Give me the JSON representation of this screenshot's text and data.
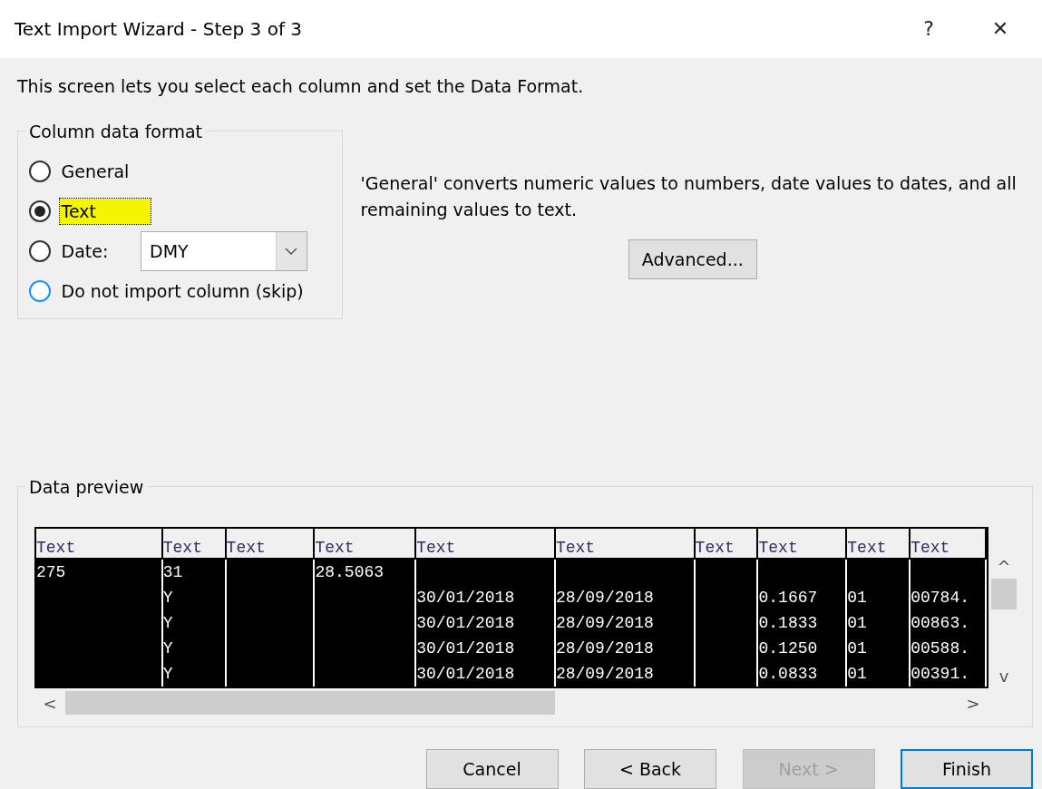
{
  "window": {
    "title": "Text Import Wizard - Step 3 of 3",
    "help": "?",
    "close": "✕"
  },
  "intro": "This screen lets you select each column and set the Data Format.",
  "column_format": {
    "legend": "Column data format",
    "options": [
      {
        "kind": "radio",
        "label": "General",
        "selected": false,
        "highlighted": false,
        "focused": false,
        "hover": false
      },
      {
        "kind": "radio",
        "label": "Text",
        "selected": true,
        "highlighted": true,
        "focused": true,
        "hover": false
      },
      {
        "kind": "select",
        "label": "Date:",
        "selected": false,
        "highlighted": false,
        "focused": false,
        "hover": false,
        "value": "DMY"
      },
      {
        "kind": "radio",
        "label": "Do not import column (skip)",
        "selected": false,
        "highlighted": false,
        "focused": false,
        "hover": true
      }
    ]
  },
  "description": "'General' converts numeric values to numbers, date values to dates, and all remaining values to text.",
  "advanced_button": "Advanced...",
  "preview": {
    "legend": "Data preview",
    "columns": [
      "Text",
      "Text",
      "Text",
      "Text",
      "Text",
      "Text",
      "Text",
      "Text",
      "Text",
      "Text"
    ],
    "rows": [
      [
        "275",
        "31",
        "",
        "28.5063",
        "",
        "",
        "",
        "",
        "",
        ""
      ],
      [
        "",
        "Y",
        "",
        "",
        "30/01/2018",
        "28/09/2018",
        "",
        "0.1667",
        "01",
        "00784."
      ],
      [
        "",
        "Y",
        "",
        "",
        "30/01/2018",
        "28/09/2018",
        "",
        "0.1833",
        "01",
        "00863."
      ],
      [
        "",
        "Y",
        "",
        "",
        "30/01/2018",
        "28/09/2018",
        "",
        "0.1250",
        "01",
        "00588."
      ],
      [
        "",
        "Y",
        "",
        "",
        "30/01/2018",
        "28/09/2018",
        "",
        "0.0833",
        "01",
        "00391."
      ]
    ],
    "scroll_up": "^",
    "scroll_down": "v",
    "scroll_left": "<",
    "scroll_right": ">"
  },
  "buttons": [
    {
      "label": "Cancel",
      "disabled": false,
      "default": false
    },
    {
      "label": "< Back",
      "disabled": false,
      "default": false
    },
    {
      "label": "Next >",
      "disabled": true,
      "default": false
    },
    {
      "label": "Finish",
      "disabled": false,
      "default": true
    }
  ]
}
